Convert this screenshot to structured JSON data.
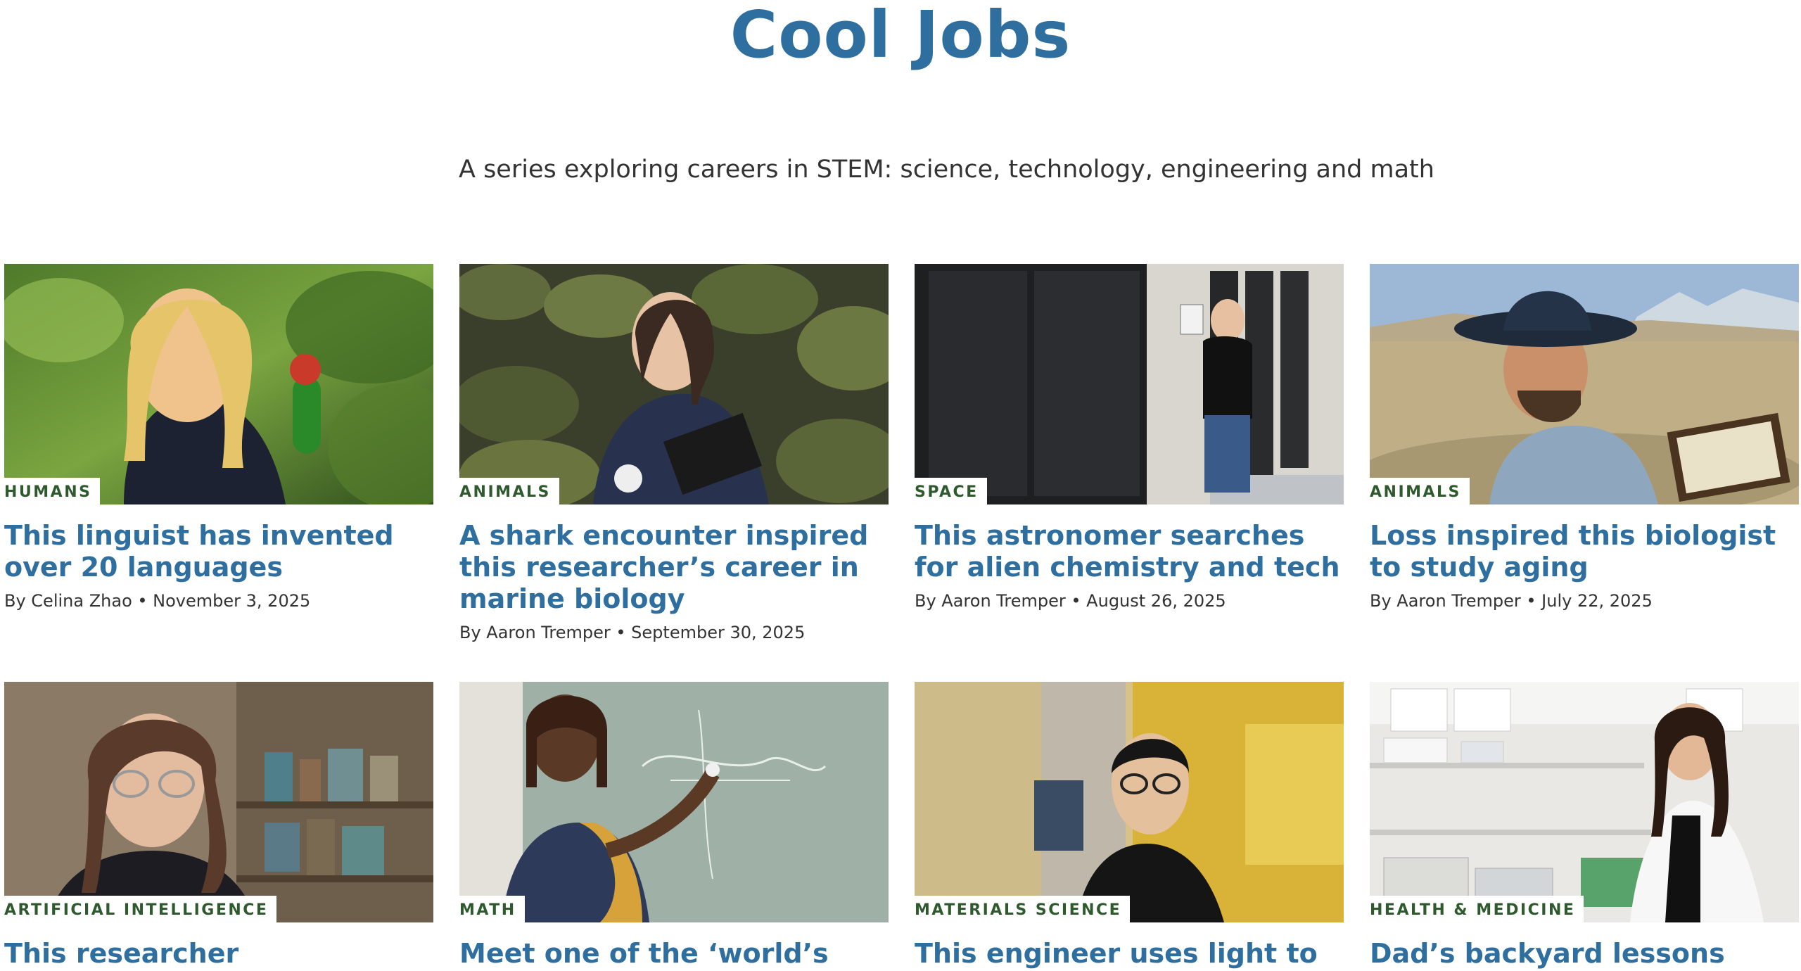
{
  "header": {
    "title": "Cool Jobs",
    "subtitle": "A series exploring careers in STEM: science, technology, engineering and math"
  },
  "articles": [
    {
      "category": "HUMANS",
      "title": "This linguist has invented over 20 languages",
      "byline": "By Celina Zhao • November 3, 2025",
      "image": "woman-with-parrot-in-jungle"
    },
    {
      "category": "ANIMALS",
      "title": "A shark encounter inspired this researcher’s career in marine biology",
      "byline": "By Aaron Tremper • September 30, 2025",
      "image": "researcher-with-clipboard-on-rocks"
    },
    {
      "category": "SPACE",
      "title": "This astronomer searches for alien chemistry and tech",
      "byline": "By Aaron Tremper • August 26, 2025",
      "image": "astronomer-by-server-racks"
    },
    {
      "category": "ANIMALS",
      "title": "Loss inspired this biologist to study aging",
      "byline": "By Aaron Tremper • July 22, 2025",
      "image": "biologist-in-cowboy-hat-prairie"
    },
    {
      "category": "ARTIFICIAL INTELLIGENCE",
      "title": "This researcher investigates the",
      "byline": "",
      "image": "researcher-with-glasses-library"
    },
    {
      "category": "MATH",
      "title": "Meet one of the ‘world’s most",
      "byline": "",
      "image": "mathematician-at-chalkboard"
    },
    {
      "category": "MATERIALS SCIENCE",
      "title": "This engineer uses light to get",
      "byline": "",
      "image": "engineer-in-yellow-lab"
    },
    {
      "category": "HEALTH & MEDICINE",
      "title": "Dad’s backyard lessons inspired",
      "byline": "",
      "image": "scientist-in-lab-coat"
    }
  ],
  "colors": {
    "title": "#2f6f9f",
    "tag": "#2e5a2e",
    "text": "#333333"
  }
}
